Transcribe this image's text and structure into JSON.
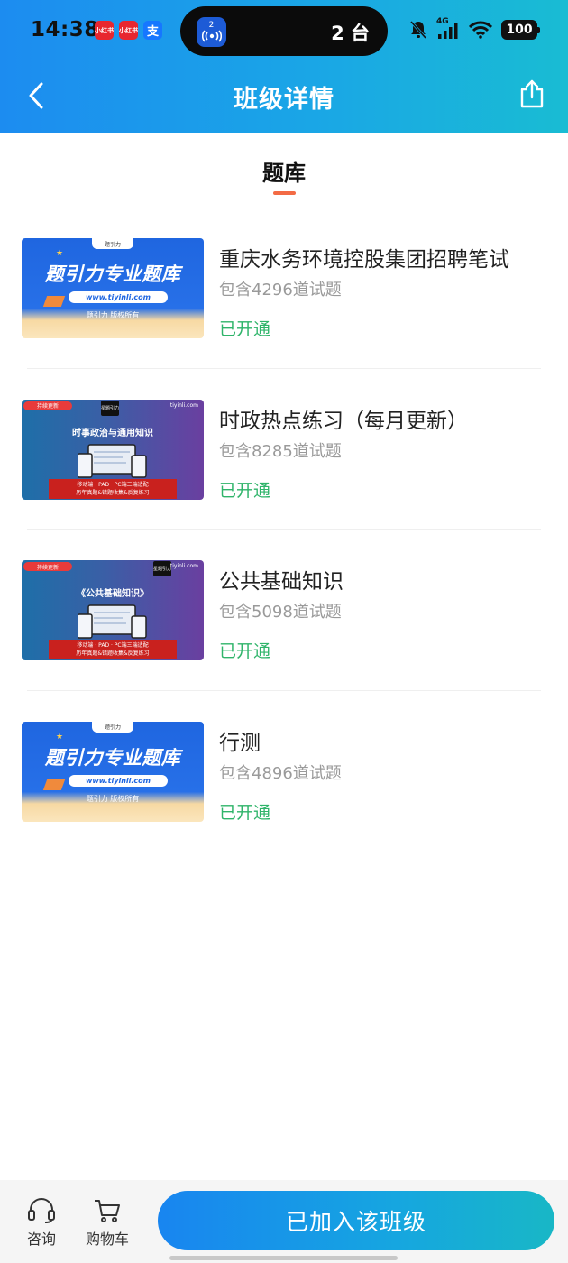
{
  "status_bar": {
    "time": "14:38",
    "app_icons": [
      "小红书",
      "小红书",
      "支"
    ],
    "island_badge": "2",
    "island_text": "2 台",
    "network": "4G",
    "battery": "100"
  },
  "nav": {
    "title": "班级详情",
    "back_icon": "chevron-left-icon",
    "share_icon": "share-icon"
  },
  "section": {
    "title": "题库",
    "accent_color": "#f36b45"
  },
  "thumb_text": {
    "a": {
      "brand": "题引力",
      "headline": "题引力专业题库",
      "url": "www.tiyinli.com",
      "copyright": "题引力 版权所有"
    },
    "b": {
      "ribbon": "持续更新",
      "logo": "星题引力",
      "site": "tiyinli.com",
      "footer_line1": "移动端 · PAD · PC端三端适配",
      "footer_line2": "历年真题&错题收集&反复练习"
    }
  },
  "banks": [
    {
      "title": "重庆水务环境控股集团招聘笔试",
      "count": "包含4296道试题",
      "status": "已开通",
      "thumb_style": "a",
      "thumb_headline": "题引力专业题库"
    },
    {
      "title": "时政热点练习（每月更新）",
      "count": "包含8285道试题",
      "status": "已开通",
      "thumb_style": "b",
      "thumb_headline": "时事政治与通用知识"
    },
    {
      "title": "公共基础知识",
      "count": "包含5098道试题",
      "status": "已开通",
      "thumb_style": "b",
      "thumb_headline": "《公共基础知识》"
    },
    {
      "title": "行测",
      "count": "包含4896道试题",
      "status": "已开通",
      "thumb_style": "a",
      "thumb_headline": "题引力专业题库"
    }
  ],
  "bottom_bar": {
    "consult_label": "咨询",
    "consult_icon": "headset-icon",
    "cart_label": "购物车",
    "cart_icon": "cart-icon",
    "join_label": "已加入该班级"
  },
  "colors": {
    "header_start": "#1c8cf0",
    "header_end": "#19bcd3",
    "status_open": "#2fb46a"
  }
}
